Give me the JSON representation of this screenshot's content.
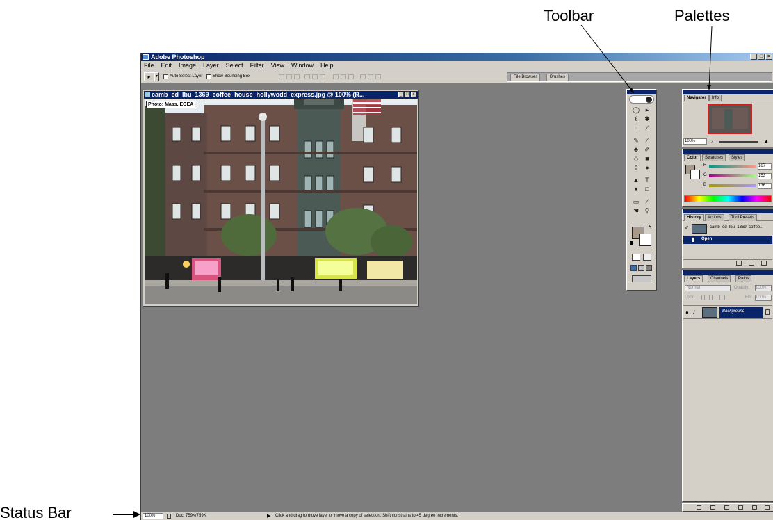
{
  "annotations": {
    "toolbar": "Toolbar",
    "palettes": "Palettes",
    "status_bar": "Status Bar"
  },
  "app": {
    "title": "Adobe Photoshop",
    "menu": [
      "File",
      "Edit",
      "Image",
      "Layer",
      "Select",
      "Filter",
      "View",
      "Window",
      "Help"
    ],
    "window_buttons": [
      "_",
      "□",
      "×"
    ]
  },
  "options_bar": {
    "auto_select_layer": "Auto Select Layer",
    "show_bounding_box": "Show Bounding Box",
    "well_tabs": [
      "File Browser",
      "Brushes"
    ]
  },
  "document": {
    "title": "camb_ed_lbu_1369_coffee_house_hollywodd_express.jpg @ 100% (R...",
    "credit": "Photo: Mass. EOEA"
  },
  "palettes": {
    "navigator": {
      "tabs": [
        "Navigator",
        "Info"
      ],
      "zoom": "100%"
    },
    "color": {
      "tabs": [
        "Color",
        "Swatches",
        "Styles"
      ],
      "channels": [
        {
          "label": "R",
          "value": "167"
        },
        {
          "label": "G",
          "value": "153"
        },
        {
          "label": "B",
          "value": "136"
        }
      ]
    },
    "history": {
      "tabs": [
        "History",
        "Actions",
        "Tool Presets"
      ],
      "snapshot": "camb_ed_lbu_1369_coffee...",
      "states": [
        "Open"
      ]
    },
    "layers": {
      "tabs": [
        "Layers",
        "Channels",
        "Paths"
      ],
      "blend_mode": "Normal",
      "opacity_label": "Opacity:",
      "opacity_value": "100%",
      "lock_label": "Lock:",
      "fill_label": "Fill:",
      "fill_value": "100%",
      "layer_name": "Background"
    }
  },
  "status_bar": {
    "zoom": "100%",
    "doc_info": "Doc: 759K/759K",
    "hint": "Click and drag to move layer or move a copy of selection. Shift constrains to 45 degree increments."
  },
  "colors": {
    "title_bar": "#0a246a",
    "chrome": "#d4d0c8",
    "workspace": "#7d7d7d",
    "foreground_swatch": "#a7998a"
  }
}
